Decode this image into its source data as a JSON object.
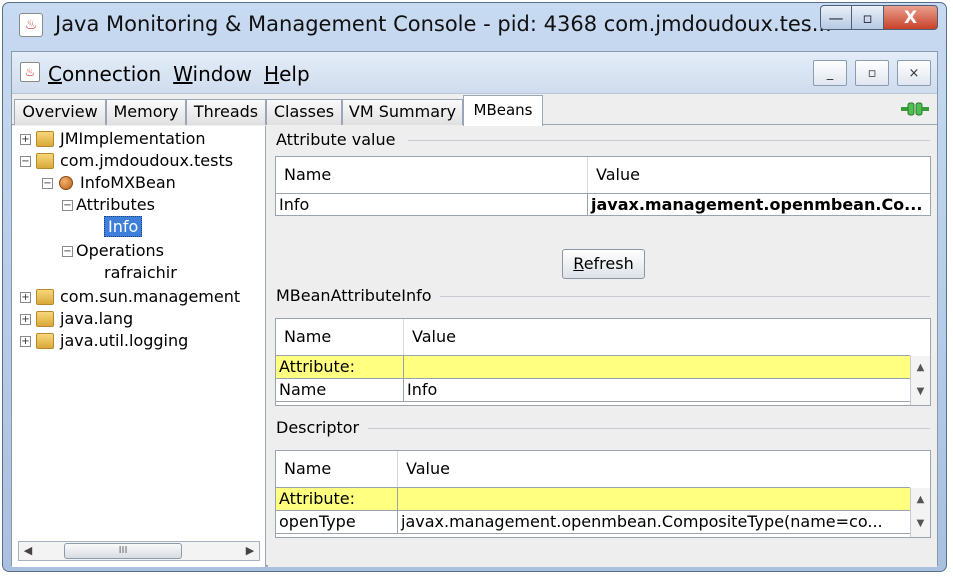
{
  "window": {
    "title": "Java Monitoring & Management Console - pid: 4368 com.jmdoudoux.tes...",
    "controls": {
      "minimize": "—",
      "maximize": "▫",
      "close": "X"
    }
  },
  "menubar": {
    "items": [
      {
        "underline": "C",
        "rest": "onnection"
      },
      {
        "underline": "W",
        "rest": "indow"
      },
      {
        "underline": "H",
        "rest": "elp"
      }
    ],
    "mdi_controls": {
      "minimize": "_",
      "restore": "▫",
      "close": "×"
    }
  },
  "tabs": [
    "Overview",
    "Memory",
    "Threads",
    "Classes",
    "VM Summary",
    "MBeans"
  ],
  "active_tab": "MBeans",
  "tree": {
    "items": [
      "JMImplementation",
      "com.jmdoudoux.tests",
      "InfoMXBean",
      "Attributes",
      "Info",
      "Operations",
      "rafraichir",
      "com.sun.management",
      "java.lang",
      "java.util.logging"
    ],
    "scroll_thumb": "III"
  },
  "attribute_value": {
    "section_title": "Attribute value",
    "columns": [
      "Name",
      "Value"
    ],
    "row": {
      "name": "Info",
      "value": "javax.management.openmbean.Co..."
    },
    "refresh": {
      "underline": "R",
      "rest": "efresh"
    }
  },
  "mbean_attribute_info": {
    "section_title": "MBeanAttributeInfo",
    "columns": [
      "Name",
      "Value"
    ],
    "rows": [
      {
        "name": "Attribute:",
        "value": ""
      },
      {
        "name": "Name",
        "value": "Info"
      }
    ]
  },
  "descriptor": {
    "section_title": "Descriptor",
    "columns": [
      "Name",
      "Value"
    ],
    "rows": [
      {
        "name": "Attribute:",
        "value": ""
      },
      {
        "name": "openType",
        "value": "javax.management.openmbean.CompositeType(name=co..."
      }
    ]
  },
  "colors": {
    "highlight_row": "#ffff80",
    "selection": "#3d7fd9"
  }
}
